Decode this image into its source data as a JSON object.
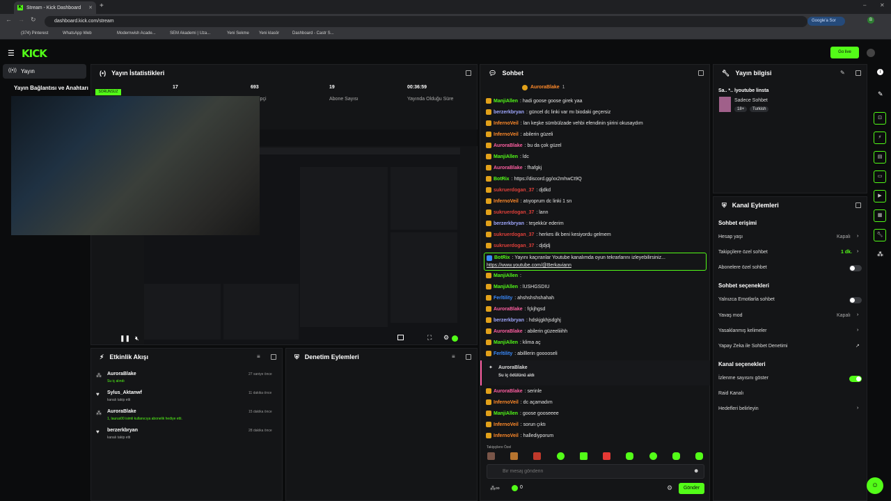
{
  "browser": {
    "tab_title": "Stream - Kick Dashboard",
    "url": "dashboard.kick.com/stream",
    "google_sor": "Google'a Sor",
    "bookmarks": [
      "(374) Pinterest",
      "WhatsApp Web",
      "Modernwish Acade...",
      "SEM Akademi | Uza...",
      "Yeni Sekme",
      "Yeni klasör",
      "Dashboard - Castr S..."
    ]
  },
  "header": {
    "logo": "KICK",
    "go_live": "Go live"
  },
  "nav": {
    "selected": "Yayın",
    "sub": "Yayın Bağlantısı ve Anahtarı"
  },
  "stats": {
    "title": "Yayın İstatistikleri",
    "badge": "SORUNSUZ",
    "viewers": "17",
    "followers": "693",
    "followers_label": "ipçi",
    "subs": "19",
    "subs_label": "Abone Sayısı",
    "time": "00:36:59",
    "time_label": "Yayında Olduğu Süre"
  },
  "chat": {
    "title": "Sohbet",
    "pinned": "AuroraBlake",
    "pinned_count": "1",
    "messages": [
      {
        "user": "ManjiAllen",
        "color": "#53fc18",
        "text": ": hadi goose goose girek yaa"
      },
      {
        "user": "berzerkbryan",
        "color": "#a0a8ff",
        "text": ": güncel dc linki var mı biodaki geçersiz"
      },
      {
        "user": "InfernoVeil",
        "color": "#ff8a2a",
        "text": ": lan keşke sümbülzade vehbi efendinin şiirini okusaydım"
      },
      {
        "user": "InfernoVeil",
        "color": "#ff8a2a",
        "text": ": abilerin güzeli"
      },
      {
        "user": "AuroraBlake",
        "color": "#ff5fa2",
        "text": ": bu da çok güzel"
      },
      {
        "user": "ManjiAllen",
        "color": "#53fc18",
        "text": ": ldc"
      },
      {
        "user": "AuroraBlake",
        "color": "#ff5fa2",
        "text": ": fhafgkj"
      },
      {
        "user": "BotRix",
        "color": "#53fc18",
        "text": ": https://discord.gg/xx2mhwCt9Q"
      },
      {
        "user": "sukruerdogan_37",
        "color": "#e0403a",
        "text": ": djdkd"
      },
      {
        "user": "InfernoVeil",
        "color": "#ff8a2a",
        "text": ": atıyoprum dc linki 1 sn"
      },
      {
        "user": "sukruerdogan_37",
        "color": "#e0403a",
        "text": ": lann"
      },
      {
        "user": "berzerkbryan",
        "color": "#a0a8ff",
        "text": ": teşekkür ederim"
      },
      {
        "user": "sukruerdogan_37",
        "color": "#e0403a",
        "text": ": herkes ilk beni kesiyordu gelmem"
      },
      {
        "user": "sukruerdogan_37",
        "color": "#e0403a",
        "text": ": djdjdj"
      }
    ],
    "botrix_hl": "BotRix",
    "botrix_hl_text": ": Yayını kaçıranlar Youtube kanalımda oyun tekrarlarını izleyebilirsiniz...",
    "botrix_hl_link": "https://www.youtube.com/@Berkaviann",
    "messages2": [
      {
        "user": "ManjiAllen",
        "color": "#53fc18",
        "text": ":"
      },
      {
        "user": "ManjiAllen",
        "color": "#53fc18",
        "text": ": lUSHGSDIU"
      },
      {
        "user": "Ferltility",
        "color": "#3a8cff",
        "text": ": ahshshshshahah"
      },
      {
        "user": "AuroraBlake",
        "color": "#ff5fa2",
        "text": ": fçkjhgsd"
      },
      {
        "user": "berzerkbryan",
        "color": "#a0a8ff",
        "text": ": hdskjgkhjsdghj"
      },
      {
        "user": "AuroraBlake",
        "color": "#ff5fa2",
        "text": ": abilerin güzeeliiihh"
      },
      {
        "user": "ManjiAllen",
        "color": "#53fc18",
        "text": ": klima aç"
      },
      {
        "user": "Ferltility",
        "color": "#3a8cff",
        "text": ": abilllerin gooooseli"
      }
    ],
    "reward_user": "AuroraBlake",
    "reward_text": "Su iç ödülünü aldı",
    "messages3": [
      {
        "user": "AuroraBlake",
        "color": "#ff5fa2",
        "text": ": serinle"
      },
      {
        "user": "InfernoVeil",
        "color": "#ff8a2a",
        "text": ": dc açamadım"
      },
      {
        "user": "ManjiAllen",
        "color": "#53fc18",
        "text": ": goose gooseeee"
      },
      {
        "user": "InfernoVeil",
        "color": "#ff8a2a",
        "text": ": sorun çıktı"
      },
      {
        "user": "InfernoVeil",
        "color": "#ff8a2a",
        "text": ": hallediyporum"
      }
    ],
    "follower_label": "Takipçilere Özel",
    "input_placeholder": "Bir mesaj gönderin",
    "send": "Gönder",
    "count": "0"
  },
  "info": {
    "title": "Yayın bilgisi",
    "stream_title": "Sa.. *.. lyoutube linsta",
    "category": "Sadece Sohbet",
    "age": "18+",
    "lang": "Turkish"
  },
  "actions": {
    "title": "Kanal Eylemleri",
    "chat_access": "Sohbet erişimi",
    "account_age": "Hesap yaşı",
    "account_age_val": "Kapalı",
    "followers_chat": "Takipçilere özel sohbet",
    "followers_chat_val": "1 dk.",
    "subs_chat": "Abonelere özel sohbet",
    "chat_options": "Sohbet seçenekleri",
    "emotes_only": "Yalnızca Emotlarla sohbet",
    "slow_mode": "Yavaş mod",
    "slow_mode_val": "Kapalı",
    "banned_words": "Yasaklanmış kelimeler",
    "ai_mod": "Yapay Zeka ile Sohbet Denetimi",
    "channel_options": "Kanal seçenekleri",
    "show_views": "İzlenme sayısını göster",
    "raid": "Raid Kanalı",
    "goals": "Hedefleri belirleyin"
  },
  "events": {
    "title": "Etkinlik Akışı",
    "items": [
      {
        "user": "AuroraBlake",
        "detail": "Su iç alındı",
        "time": "27 saniye önce"
      },
      {
        "user": "Sylus_Aktanwf",
        "detail": "kanalı takip etti",
        "time": "11 dakika önce"
      },
      {
        "user": "AuroraBlake",
        "detail": "1, laurus00 isimli kullanıcıya abonelik hediye etti.",
        "time": "15 dakika önce"
      },
      {
        "user": "berzerkbryan",
        "detail": "kanalı takip etti",
        "time": "28 dakika önce"
      }
    ]
  },
  "mod": {
    "title": "Denetim Eylemleri"
  },
  "icons": [
    "shield-icon",
    "gear-icon",
    "pause-icon",
    "mute-icon",
    "fullscreen-icon",
    "heart-icon",
    "send-icon"
  ]
}
